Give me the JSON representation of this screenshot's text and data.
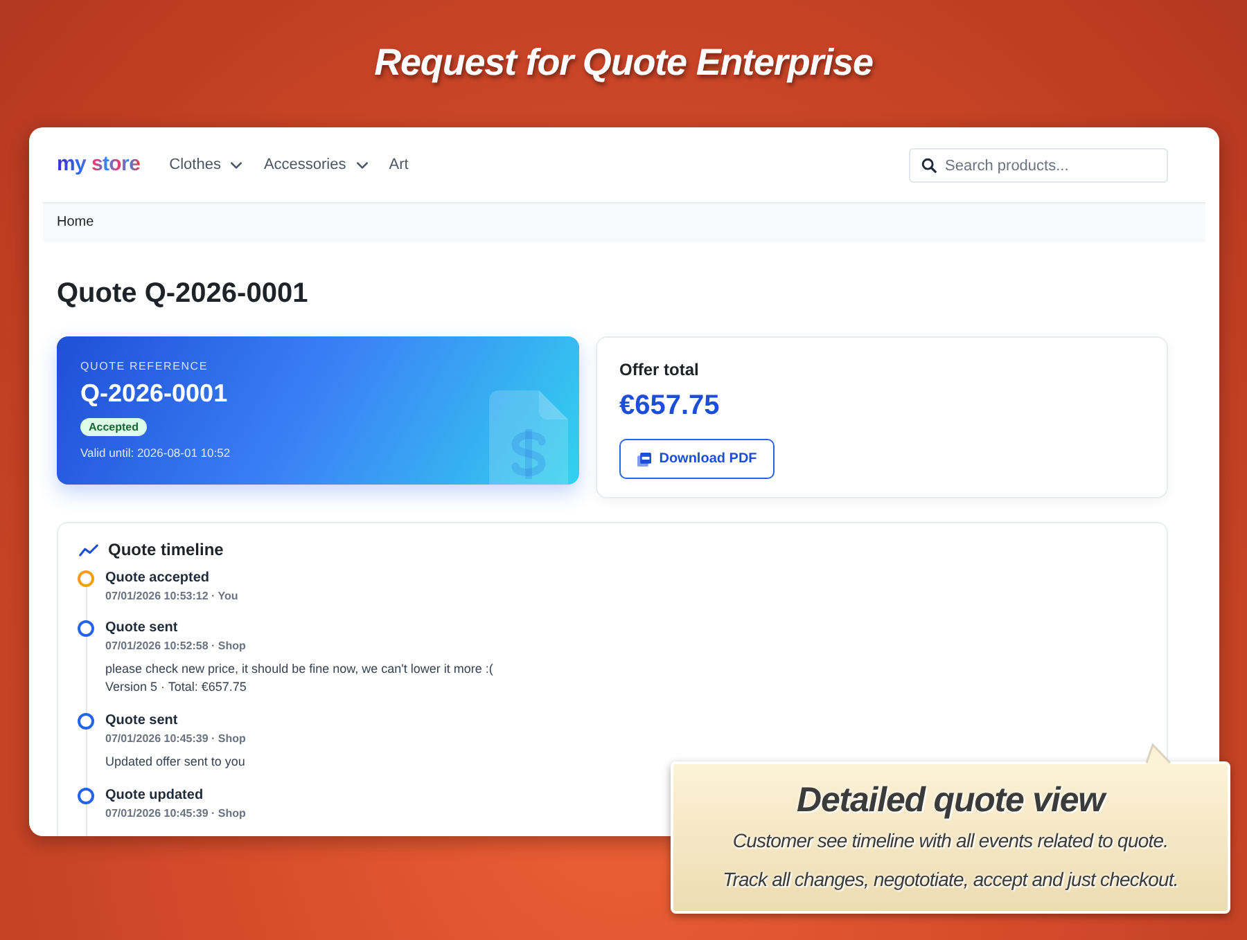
{
  "banner": {
    "title": "Request for Quote Enterprise"
  },
  "store": {
    "logo": "my store",
    "nav": [
      {
        "label": "Clothes",
        "dropdown": true
      },
      {
        "label": "Accessories",
        "dropdown": true
      },
      {
        "label": "Art",
        "dropdown": false
      }
    ],
    "search": {
      "placeholder": "Search products..."
    },
    "breadcrumb": [
      "Home"
    ]
  },
  "page_title": "Quote Q-2026-0001",
  "quote_card": {
    "label": "QUOTE REFERENCE",
    "reference": "Q-2026-0001",
    "status": "Accepted",
    "valid_until": "Valid until: 2026-08-01 10:52"
  },
  "offer": {
    "label": "Offer total",
    "amount": "€657.75",
    "button": "Download PDF"
  },
  "timeline": {
    "title": "Quote timeline",
    "events": [
      {
        "title": "Quote accepted",
        "meta": "07/01/2026 10:53:12 · You",
        "color": "#f59e0b"
      },
      {
        "title": "Quote sent",
        "meta": "07/01/2026 10:52:58 · Shop",
        "color": "#2563eb",
        "lines": [
          "please check new price, it should be fine now, we can't lower it more :(",
          "Version 5 · Total: €657.75"
        ]
      },
      {
        "title": "Quote sent",
        "meta": "07/01/2026 10:45:39 · Shop",
        "color": "#2563eb",
        "lines": [
          "Updated offer sent to you"
        ]
      },
      {
        "title": "Quote updated",
        "meta": "07/01/2026 10:45:39 · Shop",
        "color": "#2563eb"
      }
    ]
  },
  "callout": {
    "title": "Detailed quote view",
    "lines": [
      "Customer see timeline with all events related to quote.",
      "Track all changes, negototiate, accept and just checkout."
    ]
  }
}
